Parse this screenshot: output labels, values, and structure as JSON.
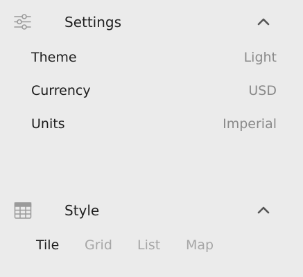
{
  "settings": {
    "title": "Settings",
    "icon": "sliders-icon",
    "expanded": true,
    "rows": [
      {
        "label": "Theme",
        "value": "Light"
      },
      {
        "label": "Currency",
        "value": "USD"
      },
      {
        "label": "Units",
        "value": "Imperial"
      }
    ]
  },
  "style": {
    "title": "Style",
    "icon": "grid-table-icon",
    "expanded": true,
    "options": [
      "Tile",
      "Grid",
      "List",
      "Map"
    ],
    "selected": "Tile"
  },
  "colors": {
    "background": "#ebebeb",
    "text_primary": "#1c1c1c",
    "text_secondary": "#8a8a8a",
    "text_inactive": "#a6a6a6",
    "icon": "#9a9a9a",
    "chevron": "#555555"
  }
}
